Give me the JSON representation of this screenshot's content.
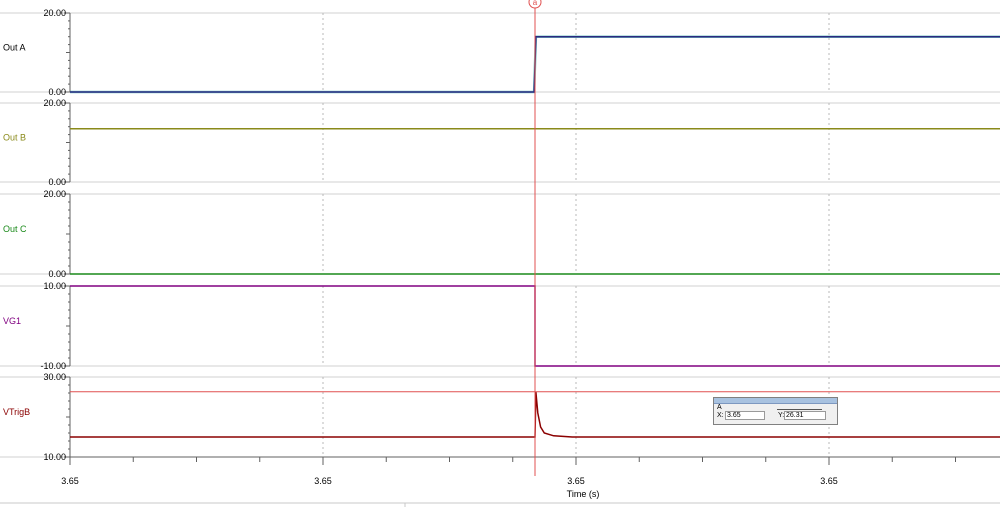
{
  "chart_data": {
    "type": "line",
    "xlabel": "Time (s)",
    "x_tick_labels": [
      "3.65",
      "3.65",
      "3.65",
      "3.65"
    ],
    "cursor": {
      "marker_label": "a",
      "readout_title": "A",
      "x_label": "X:",
      "x_value": "3.65",
      "y_label": "Y:",
      "y_value": "26.31"
    },
    "xlim": [
      0,
      100
    ],
    "cursor_x": 50,
    "grid": true,
    "panels": [
      {
        "name": "Out A",
        "name_color": "#000000",
        "ylim": [
          0,
          20
        ],
        "ytick_labels": [
          "20.00",
          "0.00"
        ],
        "series": [
          {
            "color": "#2a2a80",
            "shadow": "#20a0a0",
            "points": [
              [
                0,
                0
              ],
              [
                49.9,
                0
              ],
              [
                50.1,
                14
              ],
              [
                100,
                14
              ]
            ]
          }
        ]
      },
      {
        "name": "Out B",
        "name_color": "#8a8a1a",
        "ylim": [
          0,
          20
        ],
        "ytick_labels": [
          "20.00",
          "0.00"
        ],
        "series": [
          {
            "color": "#8a8a1a",
            "points": [
              [
                0,
                13.5
              ],
              [
                100,
                13.5
              ]
            ]
          }
        ]
      },
      {
        "name": "Out C",
        "name_color": "#1a8a1a",
        "ylim": [
          0,
          20
        ],
        "ytick_labels": [
          "20.00",
          "0.00"
        ],
        "series": [
          {
            "color": "#1a8a1a",
            "points": [
              [
                0,
                0
              ],
              [
                100,
                0
              ]
            ]
          }
        ]
      },
      {
        "name": "VG1",
        "name_color": "#800080",
        "ylim": [
          -10,
          10
        ],
        "ytick_labels": [
          "10.00",
          "-10.00"
        ],
        "series": [
          {
            "color": "#800080",
            "points": [
              [
                0,
                10
              ],
              [
                50,
                10
              ],
              [
                50,
                -10
              ],
              [
                100,
                -10
              ]
            ]
          }
        ]
      },
      {
        "name": "VTrigB",
        "name_color": "#8b0000",
        "ylim": [
          10,
          30
        ],
        "ytick_labels": [
          "30.00",
          "10.00"
        ],
        "hline": {
          "value": 26.31,
          "color": "#e05050"
        },
        "series": [
          {
            "color": "#8b0000",
            "points": [
              [
                0,
                15
              ],
              [
                50,
                15
              ],
              [
                50.1,
                26.2
              ],
              [
                50.3,
                21
              ],
              [
                50.6,
                17.5
              ],
              [
                51,
                16
              ],
              [
                52,
                15.3
              ],
              [
                54,
                15
              ],
              [
                100,
                15
              ]
            ]
          }
        ]
      }
    ]
  }
}
